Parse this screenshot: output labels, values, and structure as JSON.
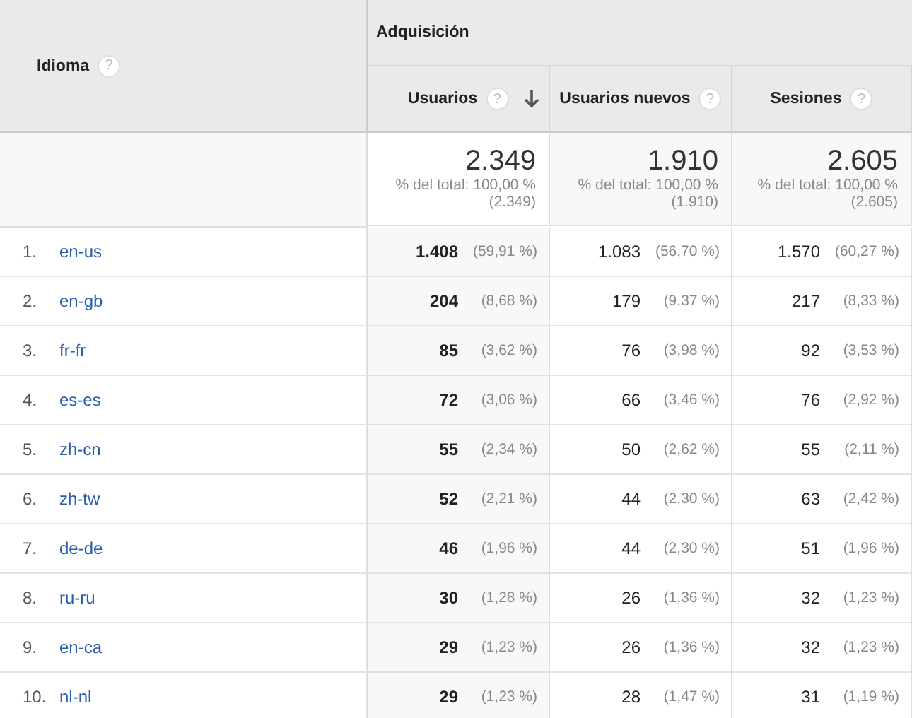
{
  "header": {
    "dimension": {
      "label": "Idioma",
      "help": "?"
    },
    "group": "Adquisición",
    "columns": [
      {
        "label": "Usuarios",
        "help": "?",
        "sorted": true
      },
      {
        "label": "Usuarios nuevos",
        "help": "?",
        "sorted": false
      },
      {
        "label": "Sesiones",
        "help": "?",
        "sorted": false
      }
    ]
  },
  "totals": [
    {
      "value": "2.349",
      "note": "% del total: 100,00 %",
      "note_value": "(2.349)"
    },
    {
      "value": "1.910",
      "note": "% del total: 100,00 %",
      "note_value": "(1.910)"
    },
    {
      "value": "2.605",
      "note": "% del total: 100,00 %",
      "note_value": "(2.605)"
    }
  ],
  "rows": [
    {
      "index": "1.",
      "language": "en-us",
      "cells": [
        {
          "value": "1.408",
          "pct": "(59,91 %)"
        },
        {
          "value": "1.083",
          "pct": "(56,70 %)"
        },
        {
          "value": "1.570",
          "pct": "(60,27 %)"
        }
      ]
    },
    {
      "index": "2.",
      "language": "en-gb",
      "cells": [
        {
          "value": "204",
          "pct": "(8,68 %)"
        },
        {
          "value": "179",
          "pct": "(9,37 %)"
        },
        {
          "value": "217",
          "pct": "(8,33 %)"
        }
      ]
    },
    {
      "index": "3.",
      "language": "fr-fr",
      "cells": [
        {
          "value": "85",
          "pct": "(3,62 %)"
        },
        {
          "value": "76",
          "pct": "(3,98 %)"
        },
        {
          "value": "92",
          "pct": "(3,53 %)"
        }
      ]
    },
    {
      "index": "4.",
      "language": "es-es",
      "cells": [
        {
          "value": "72",
          "pct": "(3,06 %)"
        },
        {
          "value": "66",
          "pct": "(3,46 %)"
        },
        {
          "value": "76",
          "pct": "(2,92 %)"
        }
      ]
    },
    {
      "index": "5.",
      "language": "zh-cn",
      "cells": [
        {
          "value": "55",
          "pct": "(2,34 %)"
        },
        {
          "value": "50",
          "pct": "(2,62 %)"
        },
        {
          "value": "55",
          "pct": "(2,11 %)"
        }
      ]
    },
    {
      "index": "6.",
      "language": "zh-tw",
      "cells": [
        {
          "value": "52",
          "pct": "(2,21 %)"
        },
        {
          "value": "44",
          "pct": "(2,30 %)"
        },
        {
          "value": "63",
          "pct": "(2,42 %)"
        }
      ]
    },
    {
      "index": "7.",
      "language": "de-de",
      "cells": [
        {
          "value": "46",
          "pct": "(1,96 %)"
        },
        {
          "value": "44",
          "pct": "(2,30 %)"
        },
        {
          "value": "51",
          "pct": "(1,96 %)"
        }
      ]
    },
    {
      "index": "8.",
      "language": "ru-ru",
      "cells": [
        {
          "value": "30",
          "pct": "(1,28 %)"
        },
        {
          "value": "26",
          "pct": "(1,36 %)"
        },
        {
          "value": "32",
          "pct": "(1,23 %)"
        }
      ]
    },
    {
      "index": "9.",
      "language": "en-ca",
      "cells": [
        {
          "value": "29",
          "pct": "(1,23 %)"
        },
        {
          "value": "26",
          "pct": "(1,36 %)"
        },
        {
          "value": "32",
          "pct": "(1,23 %)"
        }
      ]
    },
    {
      "index": "10.",
      "language": "nl-nl",
      "cells": [
        {
          "value": "29",
          "pct": "(1,23 %)"
        },
        {
          "value": "28",
          "pct": "(1,47 %)"
        },
        {
          "value": "31",
          "pct": "(1,19 %)"
        }
      ]
    }
  ]
}
